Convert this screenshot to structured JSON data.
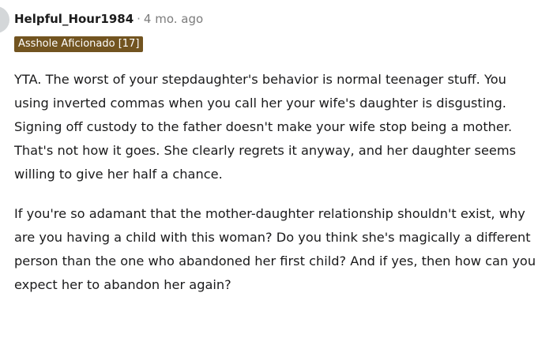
{
  "comment": {
    "username": "Helpful_Hour1984",
    "separator": "·",
    "timestamp": "4 mo. ago",
    "flair": "Asshole Aficionado [17]",
    "paragraphs": [
      "YTA. The worst of your stepdaughter's behavior is normal teenager stuff. You using inverted commas when you call her your wife's daughter is disgusting. Signing off custody to the father doesn't make your wife stop being a mother. That's not how it goes. She clearly regrets it anyway, and her daughter seems willing to give her half a chance.",
      "If you're so adamant that the mother-daughter relationship shouldn't exist, why are you having a child with this woman? Do you think she's magically a different person than the one who abandoned her first child? And if yes, then how can you expect her to abandon her again?"
    ]
  },
  "colors": {
    "flair_background": "#725420",
    "flair_text": "#ffffff",
    "meta_gray": "#7c7c7c",
    "body_text": "#1a1a1b"
  }
}
